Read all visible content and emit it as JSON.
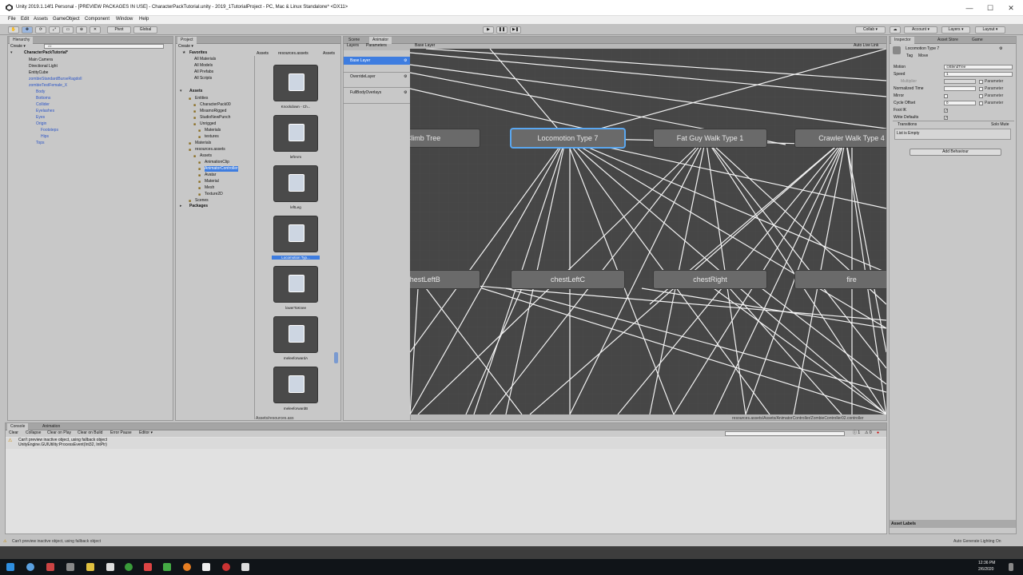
{
  "window": {
    "title": "Unity 2019.1.14f1 Personal - [PREVIEW PACKAGES IN USE] - CharacterPackTutorial.unity - 2019_1TutorialProject - PC, Mac & Linux Standalone* <DX11>",
    "minimize": "—",
    "maximize": "☐",
    "close": "✕"
  },
  "menu": [
    "File",
    "Edit",
    "Assets",
    "GameObject",
    "Component",
    "Window",
    "Help"
  ],
  "toolbar": {
    "pivot": "Pivot",
    "global": "Global",
    "collab": "Collab ▾",
    "account": "Account ▾",
    "layers": "Layers ▾",
    "layout": "Layout ▾"
  },
  "hierarchy": {
    "tab": "Hierarchy",
    "create": "Create ▾",
    "search_placeholder": "All",
    "scene": "CharacterPackTutorial*",
    "items": [
      {
        "label": "Main Camera",
        "level": 2,
        "blue": false
      },
      {
        "label": "Directional Light",
        "level": 2,
        "blue": false
      },
      {
        "label": "EntityCube",
        "level": 2,
        "blue": false
      },
      {
        "label": "zombieStandardBurseRagdoll",
        "level": 2,
        "blue": true
      },
      {
        "label": "zombieTestFemale_X",
        "level": 2,
        "blue": true
      },
      {
        "label": "Body",
        "level": 3,
        "blue": true
      },
      {
        "label": "Bottoms",
        "level": 3,
        "blue": true
      },
      {
        "label": "Collider",
        "level": 3,
        "blue": true
      },
      {
        "label": "Eyelashes",
        "level": 3,
        "blue": true
      },
      {
        "label": "Eyes",
        "level": 3,
        "blue": true
      },
      {
        "label": "Origin",
        "level": 3,
        "blue": true
      },
      {
        "label": "Footsteps",
        "level": 4,
        "blue": true
      },
      {
        "label": "Hips",
        "level": 4,
        "blue": true
      },
      {
        "label": "Tops",
        "level": 3,
        "blue": true
      }
    ]
  },
  "project": {
    "tab": "Project",
    "create": "Create ▾",
    "breadcrumb": [
      "Assets",
      "resources.assets",
      "Assets"
    ],
    "favorites_header": "Favorites",
    "favorites": [
      "All Materials",
      "All Models",
      "All Prefabs",
      "All Scripts"
    ],
    "assets_header": "Assets",
    "tree": [
      {
        "label": "Entities",
        "level": 1
      },
      {
        "label": "CharacterPack00",
        "level": 2
      },
      {
        "label": "MixamoRigged",
        "level": 2
      },
      {
        "label": "StudioNewPunch",
        "level": 2
      },
      {
        "label": "Unrigged",
        "level": 2
      },
      {
        "label": "Materials",
        "level": 3
      },
      {
        "label": "textures",
        "level": 3
      },
      {
        "label": "Materials",
        "level": 1
      },
      {
        "label": "resources.assets",
        "level": 1
      },
      {
        "label": "Assets",
        "level": 2
      },
      {
        "label": "AnimationClip",
        "level": 3
      },
      {
        "label": "AnimatorController",
        "level": 3,
        "selected": true
      },
      {
        "label": "Avatar",
        "level": 3
      },
      {
        "label": "Material",
        "level": 3
      },
      {
        "label": "Mesh",
        "level": 3
      },
      {
        "label": "Texture2D",
        "level": 3
      },
      {
        "label": "Scenes",
        "level": 1
      }
    ],
    "packages_header": "Packages",
    "tiles": [
      "Knockdown - Ch...",
      "leftArm",
      "leftLeg",
      "Locomotion Typ...",
      "lowerToKnee",
      "meleeforwardA",
      "meleeforwardB"
    ],
    "footer": "Assets/resources.ass"
  },
  "animator": {
    "tabs": [
      "Scene",
      "Animator"
    ],
    "subtabs": [
      "Layers",
      "Parameters"
    ],
    "breadcrumb": "Base Layer",
    "auto_live_link": "Auto Live Link",
    "layers": [
      "Base Layer",
      "OverrideLayer",
      "FullBodyOverlays"
    ],
    "nodes_row1": [
      "Climb Tree",
      "Locomotion Type 7",
      "Fat Guy Walk Type 1",
      "Crawler Walk Type 4"
    ],
    "nodes_row2": [
      "chestLeftB",
      "chestLeftC",
      "chestRight",
      "fire"
    ],
    "footer_path": "resources.assets/Assets/AnimatorController/ZombieController02.controller"
  },
  "inspector": {
    "tabs": [
      "Inspector",
      "Asset Store",
      "Game"
    ],
    "name": "Locomotion Type 7",
    "tag_label": "Tag",
    "move_label": "Move",
    "fields": [
      {
        "label": "Motion",
        "value": "⊙BlendTree",
        "param": ""
      },
      {
        "label": "Speed",
        "value": "1",
        "param": ""
      },
      {
        "label": "Multiplier",
        "value": "",
        "param": "Parameter"
      },
      {
        "label": "Normalized Time",
        "value": "",
        "param": "Parameter"
      },
      {
        "label": "Mirror",
        "value": "",
        "param": "Parameter"
      },
      {
        "label": "Cycle Offset",
        "value": "0",
        "param": "Parameter"
      },
      {
        "label": "Foot IK",
        "value": "",
        "param": ""
      },
      {
        "label": "Write Defaults",
        "value": "",
        "param": ""
      }
    ],
    "transitions_label": "Transitions",
    "solo_mute": "Solo  Mute",
    "list_empty": "List is Empty",
    "add_behaviour": "Add Behaviour",
    "asset_labels": "Asset Labels"
  },
  "console": {
    "tabs": [
      "Console",
      "Animation"
    ],
    "buttons": [
      "Clear",
      "Collapse",
      "Clear on Play",
      "Clear on Build",
      "Error Pause",
      "Editor ▾"
    ],
    "messages": [
      {
        "line1": "Can't preview inactive object, using fallback object",
        "line2": "UnityEngine.GUIUtility:ProcessEvent(Int32, IntPtr)"
      }
    ]
  },
  "statusbar": {
    "message": "Can't preview inactive object, using fallback object",
    "right": "Auto Generate Lighting On"
  },
  "taskbar": {
    "time": "12:36 PM",
    "date": "2/6/2020"
  }
}
